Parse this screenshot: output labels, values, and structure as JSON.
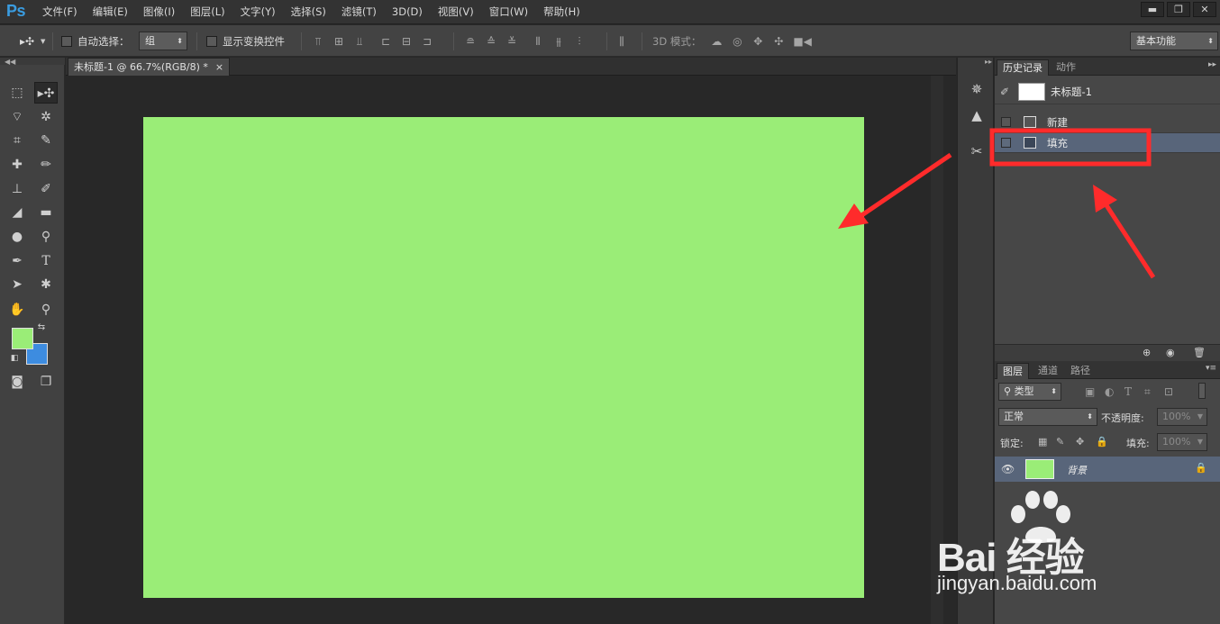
{
  "app": {
    "logo": "Ps"
  },
  "menu": [
    "文件(F)",
    "编辑(E)",
    "图像(I)",
    "图层(L)",
    "文字(Y)",
    "选择(S)",
    "滤镜(T)",
    "3D(D)",
    "视图(V)",
    "窗口(W)",
    "帮助(H)"
  ],
  "window_controls": {
    "minimize": "▬",
    "restore": "❐",
    "close": "✕"
  },
  "options": {
    "auto_select_label": "自动选择：",
    "auto_select_value": "组",
    "show_transform_label": "显示变换控件",
    "mode_3d_label": "3D 模式：",
    "workspace": "基本功能"
  },
  "document": {
    "tab_title": "未标题-1 @ 66.7%(RGB/8) *",
    "tab_close": "×",
    "canvas_fill": "#9aed77"
  },
  "colors": {
    "foreground": "#9aed77",
    "background": "#3d8ce0",
    "highlight_red": "#ff2b2b",
    "selected_row": "#58657a"
  },
  "history_panel": {
    "tabs": [
      "历史记录",
      "动作"
    ],
    "snapshot": "未标题-1",
    "steps": [
      "新建",
      "填充"
    ],
    "selected_step": "填充"
  },
  "layers_panel": {
    "tabs": [
      "图层",
      "通道",
      "路径"
    ],
    "filter_kind": "类型",
    "blend_mode": "正常",
    "opacity_label": "不透明度:",
    "opacity_value": "100%",
    "lock_label": "锁定:",
    "fill_label": "填充:",
    "fill_value": "100%",
    "layers": [
      {
        "name": "背景",
        "locked": true,
        "visible": true
      }
    ]
  },
  "watermark": {
    "brand": "Bai 经验",
    "url": "jingyan.baidu.com"
  }
}
